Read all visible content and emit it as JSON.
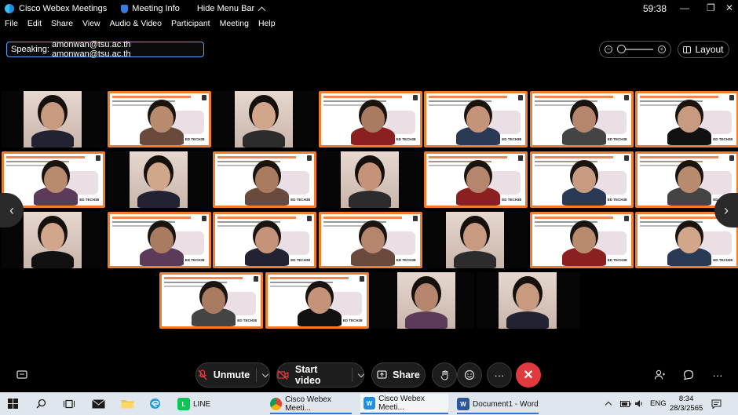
{
  "titlebar": {
    "app_name": "Cisco Webex Meetings",
    "meeting_info": "Meeting Info",
    "hide_menu": "Hide Menu Bar",
    "timer": "59:38",
    "minimize": "—",
    "restore": "❐",
    "close": "✕"
  },
  "menu": {
    "file": "File",
    "edit": "Edit",
    "share": "Share",
    "view": "View",
    "audio_video": "Audio & Video",
    "participant": "Participant",
    "meeting": "Meeting",
    "help": "Help"
  },
  "speaking": {
    "prefix": "Speaking:",
    "names": "amonwan@tsu.ac.th amonwan@tsu.ac.th"
  },
  "view_controls": {
    "zoom_out": "−",
    "zoom_in": "+",
    "zoom_level": 0,
    "layout_label": "Layout"
  },
  "slide_brand": "ED TECH38",
  "video_tiles": [
    {
      "row": 1,
      "kind": "camera"
    },
    {
      "row": 1,
      "kind": "slide"
    },
    {
      "row": 1,
      "kind": "camera"
    },
    {
      "row": 1,
      "kind": "slide"
    },
    {
      "row": 1,
      "kind": "slide"
    },
    {
      "row": 1,
      "kind": "slide"
    },
    {
      "row": 1,
      "kind": "slide"
    },
    {
      "row": 2,
      "kind": "slide"
    },
    {
      "row": 2,
      "kind": "camera"
    },
    {
      "row": 2,
      "kind": "slide"
    },
    {
      "row": 2,
      "kind": "camera"
    },
    {
      "row": 2,
      "kind": "slide"
    },
    {
      "row": 2,
      "kind": "slide"
    },
    {
      "row": 2,
      "kind": "slide"
    },
    {
      "row": 3,
      "kind": "camera"
    },
    {
      "row": 3,
      "kind": "slide"
    },
    {
      "row": 3,
      "kind": "slide"
    },
    {
      "row": 3,
      "kind": "slide"
    },
    {
      "row": 3,
      "kind": "camera"
    },
    {
      "row": 3,
      "kind": "slide"
    },
    {
      "row": 3,
      "kind": "slide"
    },
    {
      "row": 4,
      "kind": "slide"
    },
    {
      "row": 4,
      "kind": "slide"
    },
    {
      "row": 4,
      "kind": "camera"
    },
    {
      "row": 4,
      "kind": "camera"
    }
  ],
  "nav": {
    "prev": "‹",
    "next": "›"
  },
  "controls": {
    "unmute": "Unmute",
    "start_video": "Start video",
    "share": "Share",
    "more": "···",
    "end": "✕",
    "more_right": "···"
  },
  "taskbar": {
    "apps": [
      {
        "label": "LINE",
        "icon": "line-icon",
        "color": "#06c755"
      },
      {
        "label": "Cisco Webex Meeti...",
        "icon": "chrome-icon",
        "color": "#db4437"
      },
      {
        "label": "Cisco Webex Meeti...",
        "icon": "webex-icon",
        "color": "#1f8fe0"
      },
      {
        "label": "Document1 - Word",
        "icon": "word-icon",
        "color": "#2b579a"
      }
    ],
    "language": "ENG",
    "time": "8:34",
    "date": "28/3/2565"
  },
  "colors": {
    "accent_blue": "#5aa0ff",
    "end_red": "#e0393e",
    "slide_orange": "#f07d2c"
  }
}
